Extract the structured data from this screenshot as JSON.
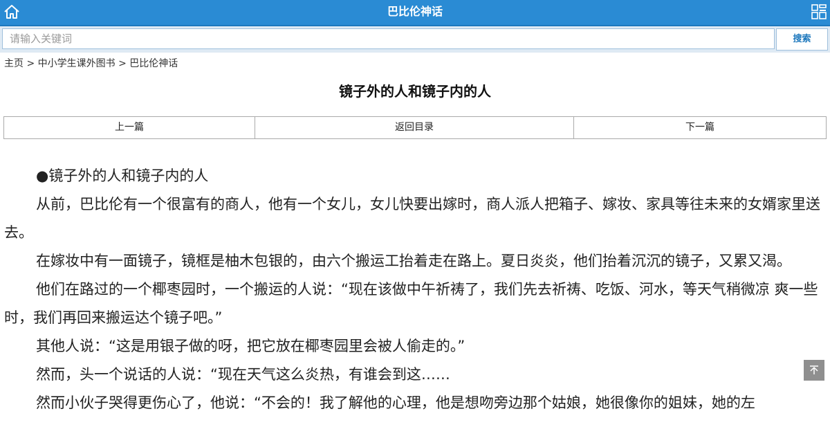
{
  "header": {
    "title": "巴比伦神话",
    "home_icon": "home-icon",
    "menu_icon": "grid-menu-icon"
  },
  "search": {
    "placeholder": "请输入关键词",
    "value": "",
    "button_label": "搜索"
  },
  "breadcrumb": {
    "items": [
      "主页",
      "中小学生课外图书",
      "巴比伦神话"
    ],
    "separator": ">"
  },
  "article": {
    "title": "镜子外的人和镜子内的人",
    "paragraphs": [
      "●镜子外的人和镜子内的人",
      "从前，巴比伦有一个很富有的商人，他有一个女儿，女儿快要出嫁时，商人派人把箱子、嫁妆、家具等往未来的女婿家里送去。",
      "在嫁妆中有一面镜子，镜框是柚木包银的，由六个搬运工抬着走在路上。夏日炎炎，他们抬着沉沉的镜子，又累又渴。",
      "他们在路过的一个椰枣园时，一个搬运的人说：“现在该做中午祈祷了，我们先去祈祷、吃饭、河水，等天气稍微凉 爽一些时，我们再回来搬运达个镜子吧。”",
      "其他人说：“这是用银子做的呀，把它放在椰枣园里会被人偷走的。”",
      "然而，头一个说话的人说：“现在天气这么炎热，有谁会到这……",
      "然而小伙子哭得更伤心了，他说：“不会的！我了解他的心理，他是想吻旁边那个姑娘，她很像你的姐妹，她的左"
    ]
  },
  "pager": {
    "prev_label": "上一篇",
    "toc_label": "返回目录",
    "next_label": "下一篇"
  },
  "colors": {
    "header_bg": "#2a8bd4",
    "search_bg": "#dfeaf4",
    "accent": "#1d78bd",
    "backtop_bg": "#8f8f8f"
  },
  "backtop_icon": "back-to-top-icon"
}
